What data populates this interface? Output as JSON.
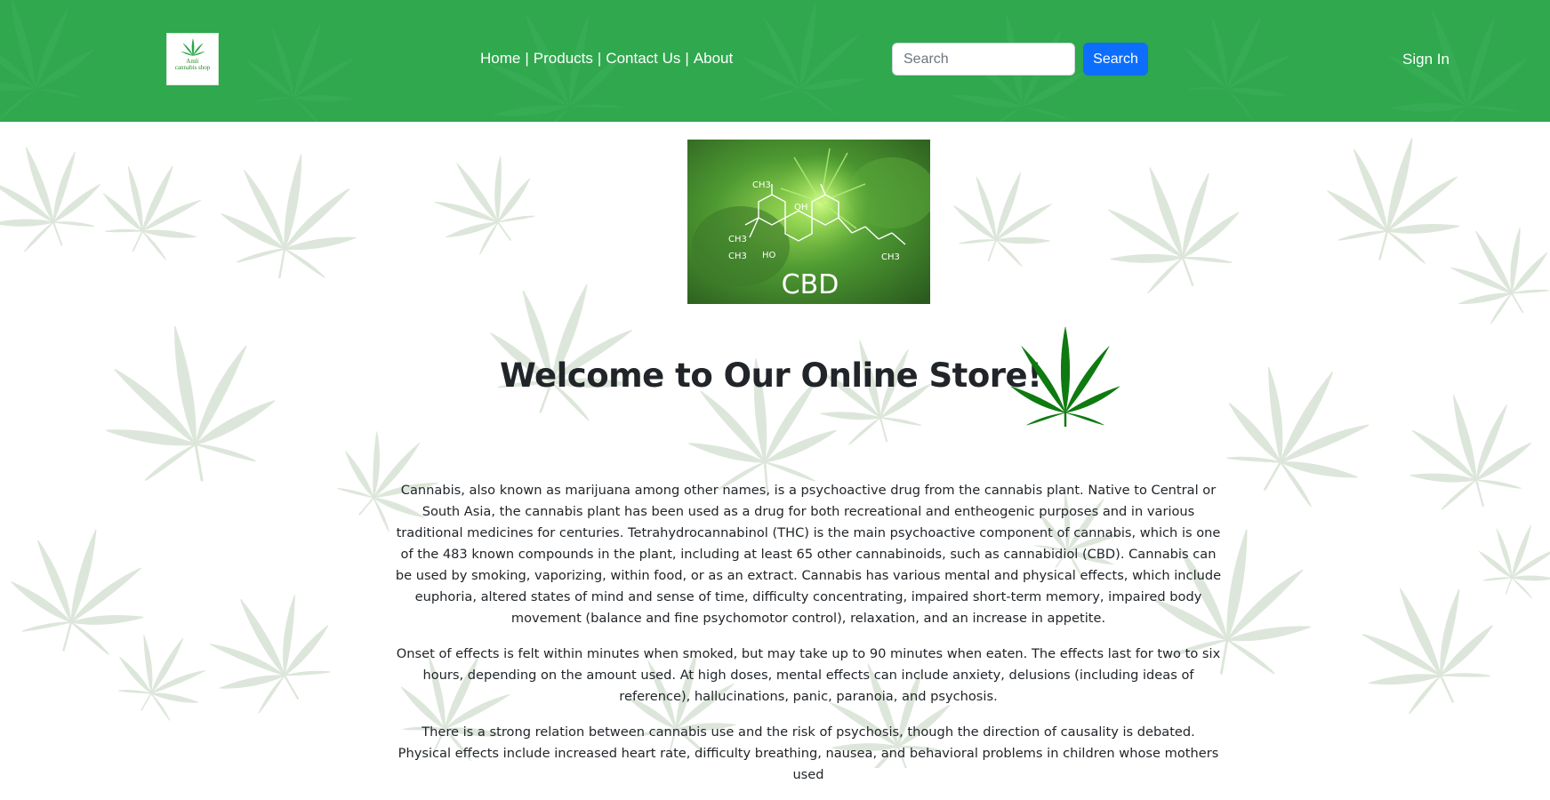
{
  "header": {
    "logo": {
      "text_line1": "Amli",
      "text_line2": "cannabis shop",
      "icon": "cannabis-leaf-icon"
    },
    "nav": [
      {
        "label": "Home"
      },
      {
        "label": "Products"
      },
      {
        "label": "Contact Us"
      },
      {
        "label": "About"
      }
    ],
    "nav_separator": "|",
    "search": {
      "placeholder": "Search",
      "value": "",
      "button_label": "Search"
    },
    "signin_label": "Sign In"
  },
  "hero_image": {
    "label": "CBD",
    "chemical_labels": [
      "CH3",
      "OH",
      "CH3",
      "CH3",
      "HO",
      "CH3"
    ]
  },
  "main": {
    "title": "Welcome to Our Online Store!",
    "leaf_icon": "cannabis-leaf-icon",
    "paragraphs": [
      "Cannabis, also known as marijuana among other names, is a psychoactive drug from the cannabis plant. Native to Central or South Asia, the cannabis plant has been used as a drug for both recreational and entheogenic purposes and in various traditional medicines for centuries. Tetrahydrocannabinol (THC) is the main psychoactive component of cannabis, which is one of the 483 known compounds in the plant, including at least 65 other cannabinoids, such as cannabidiol (CBD). Cannabis can be used by smoking, vaporizing, within food, or as an extract. Cannabis has various mental and physical effects, which include euphoria, altered states of mind and sense of time, difficulty concentrating, impaired short-term memory, impaired body movement (balance and fine psychomotor control), relaxation, and an increase in appetite.",
      "Onset of effects is felt within minutes when smoked, but may take up to 90 minutes when eaten. The effects last for two to six hours, depending on the amount used. At high doses, mental effects can include anxiety, delusions (including ideas of reference), hallucinations, panic, paranoia, and psychosis.",
      "There is a strong relation between cannabis use and the risk of psychosis, though the direction of causality is debated. Physical effects include increased heart rate, difficulty breathing, nausea, and behavioral problems in children whose mothers used"
    ]
  },
  "colors": {
    "header_green": "#2fa84e",
    "primary_blue": "#0d6efd",
    "leaf_green": "#0e7a10",
    "text_dark": "#212529"
  }
}
